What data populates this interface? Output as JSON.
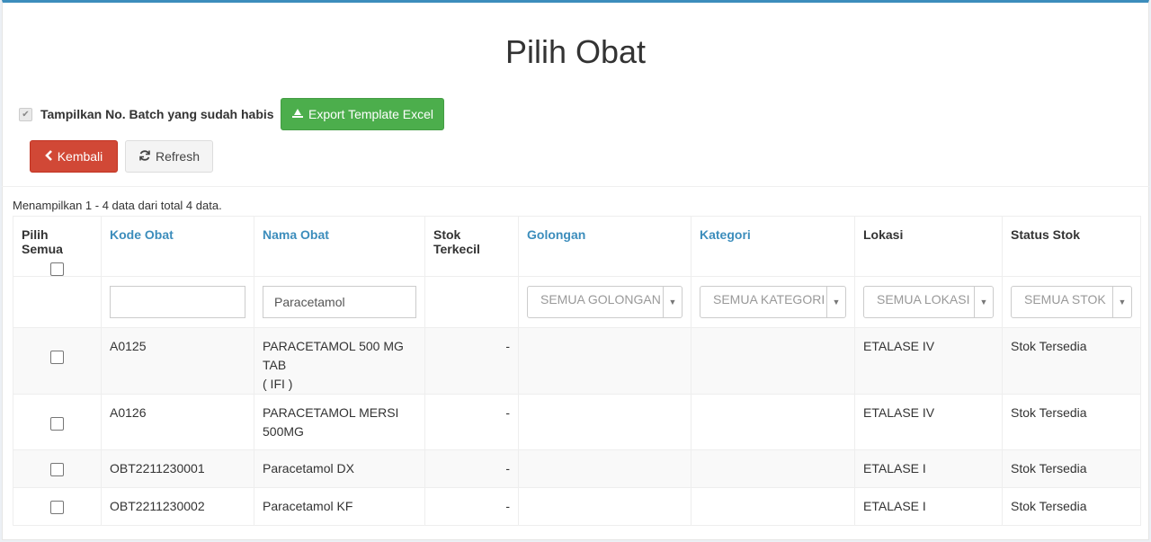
{
  "page": {
    "title": "Pilih Obat"
  },
  "toolbar": {
    "show_batch_label": "Tampilkan No. Batch yang sudah habis",
    "show_batch_checked": true,
    "export_label": "Export Template Excel",
    "back_label": "Kembali",
    "refresh_label": "Refresh"
  },
  "summary": "Menampilkan 1 - 4 data dari total 4 data.",
  "table": {
    "headers": {
      "select_all": "Pilih Semua",
      "kode": "Kode Obat",
      "nama": "Nama Obat",
      "stok_terkecil": "Stok Terkecil",
      "golongan": "Golongan",
      "kategori": "Kategori",
      "lokasi": "Lokasi",
      "status": "Status Stok"
    },
    "filters": {
      "kode_value": "",
      "nama_value": "Paracetamol",
      "golongan": "SEMUA GOLONGAN",
      "kategori": "SEMUA KATEGORI",
      "lokasi": "SEMUA LOKASI",
      "status": "SEMUA STOK"
    },
    "rows": [
      {
        "kode": "A0125",
        "nama_1": "PARACETAMOL 500 MG TAB",
        "nama_2": "( IFI )",
        "stok": "-",
        "golongan": "",
        "kategori": "",
        "lokasi": "ETALASE IV",
        "status": "Stok Tersedia"
      },
      {
        "kode": "A0126",
        "nama_1": "PARACETAMOL MERSI",
        "nama_2": "500MG",
        "stok": "-",
        "golongan": "",
        "kategori": "",
        "lokasi": "ETALASE IV",
        "status": "Stok Tersedia"
      },
      {
        "kode": "OBT2211230001",
        "nama_1": "Paracetamol DX",
        "nama_2": "",
        "stok": "-",
        "golongan": "",
        "kategori": "",
        "lokasi": "ETALASE I",
        "status": "Stok Tersedia"
      },
      {
        "kode": "OBT2211230002",
        "nama_1": "Paracetamol KF",
        "nama_2": "",
        "stok": "-",
        "golongan": "",
        "kategori": "",
        "lokasi": "ETALASE I",
        "status": "Stok Tersedia"
      }
    ]
  },
  "colors": {
    "accent": "#3c8dbc",
    "export": "#4cae4c",
    "back": "#d14836"
  },
  "icons": {
    "export": "file-excel-icon",
    "back": "chevron-left-icon",
    "refresh": "refresh-icon",
    "select": "caret-down-icon"
  }
}
